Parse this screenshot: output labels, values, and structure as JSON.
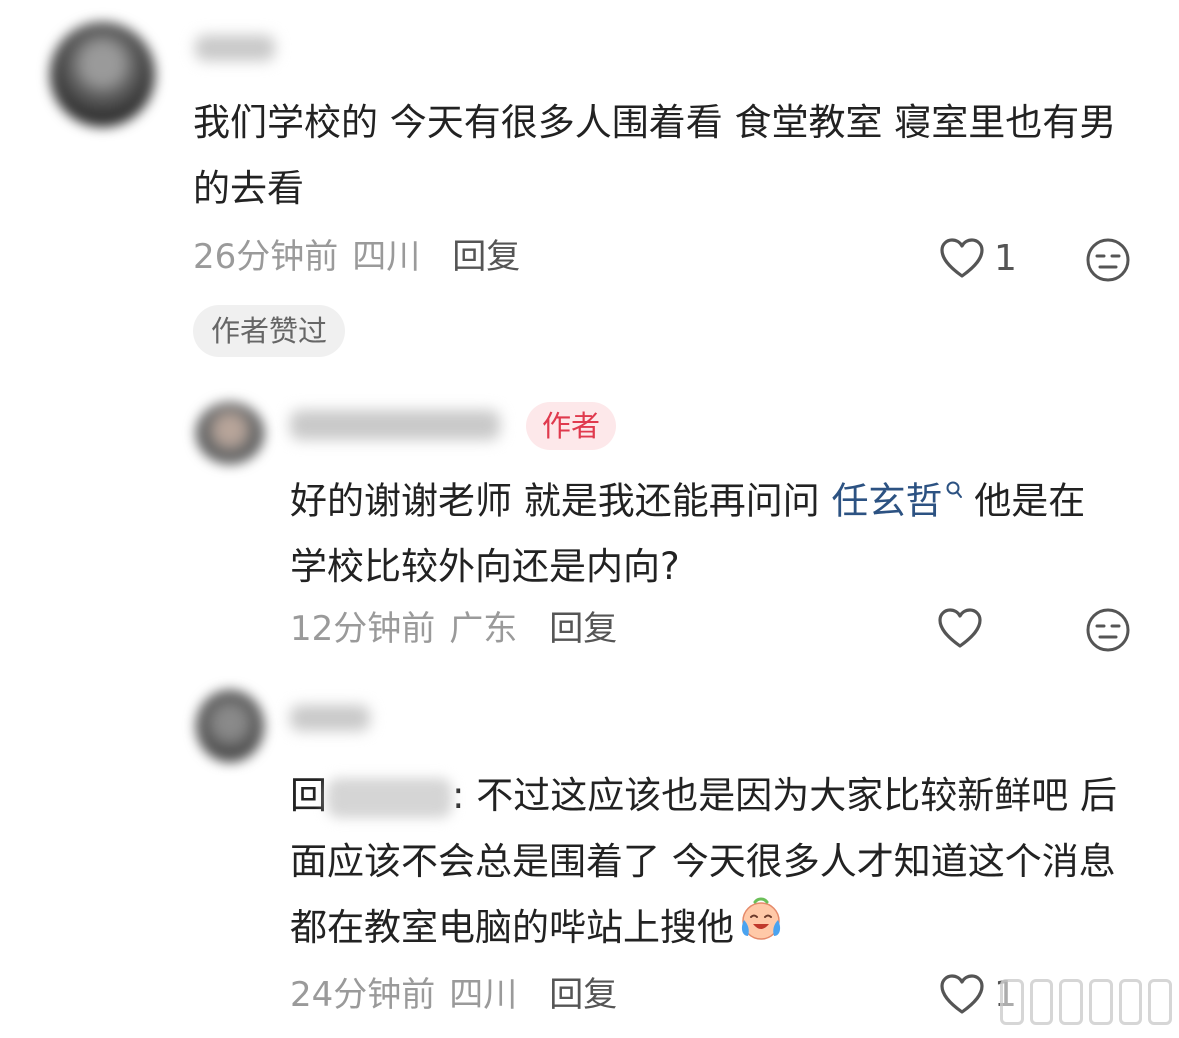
{
  "comments": {
    "main": {
      "text": "我们学校的  今天有很多人围着看  食堂教室  寝室里也有男的去看",
      "time": "26分钟前",
      "region": "四川",
      "reply_label": "回复",
      "like_count": "1",
      "liked_badge": "作者赞过"
    },
    "reply1": {
      "author_badge": "作者",
      "text_before": "好的谢谢老师 就是我还能再问问 ",
      "mention": "任玄哲",
      "text_after": " 他是在学校比较外向还是内向?",
      "time": "12分钟前",
      "region": "广东",
      "reply_label": "回复"
    },
    "reply2": {
      "reply_prefix": "回",
      "text": ": 不过这应该也是因为大家比较新鲜吧  后面应该不会总是围着了  今天很多人才知道这个消息  都在教室电脑的哔站上搜他",
      "time": "24分钟前",
      "region": "四川",
      "reply_label": "回复",
      "like_count": "1"
    }
  },
  "icons": {
    "like": "heart-outline-icon",
    "dislike": "neutral-face-icon",
    "search": "search-icon",
    "emoji": "crying-laughing-emoji-icon"
  },
  "colors": {
    "text": "#222222",
    "meta": "#9a9a9a",
    "mention": "#2c5282",
    "author_badge_bg": "#fde8ea",
    "author_badge_text": "#e03a4e"
  }
}
